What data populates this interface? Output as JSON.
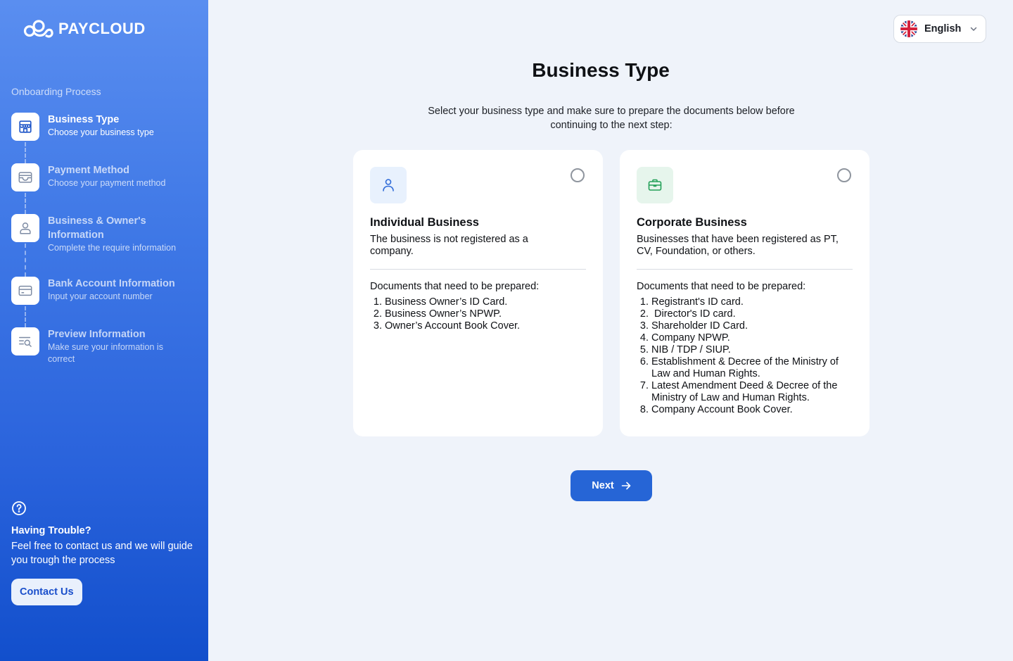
{
  "brand": {
    "name": "PAYCLOUD"
  },
  "sidebar": {
    "section_label": "Onboarding Process",
    "steps": [
      {
        "title": "Business Type",
        "subtitle": "Choose your business type",
        "icon": "store-icon",
        "active": true
      },
      {
        "title": "Payment Method",
        "subtitle": "Choose your payment method",
        "icon": "wallet-icon",
        "active": false
      },
      {
        "title": "Business & Owner's Information",
        "subtitle": "Complete the require information",
        "icon": "person-card-icon",
        "active": false
      },
      {
        "title": "Bank Account Information",
        "subtitle": "Input your account number",
        "icon": "card-icon",
        "active": false
      },
      {
        "title": "Preview Information",
        "subtitle": "Make sure your information is correct",
        "icon": "preview-search-icon",
        "active": false
      }
    ],
    "help": {
      "title": "Having Trouble?",
      "text": "Feel free to contact us and we will guide you trough the process",
      "button": "Contact Us"
    }
  },
  "language": {
    "selected": "English"
  },
  "main": {
    "title": "Business Type",
    "subtitle": "Select your business type and make sure to prepare the documents below before continuing to the next step:",
    "cards": [
      {
        "title": "Individual Business",
        "description": "The business is not registered as a company.",
        "docs_heading": "Documents that need to be prepared:",
        "docs": [
          "Business Owner’s ID Card.",
          "Business Owner’s NPWP.",
          "Owner’s Account Book Cover."
        ],
        "selected": false
      },
      {
        "title": "Corporate Business",
        "description": "Businesses that have been registered as PT, CV, Foundation, or others.",
        "docs_heading": "Documents that need to be prepared:",
        "docs": [
          "Registrant's ID card.",
          " Director's ID card.",
          "Shareholder ID Card.",
          "Company NPWP.",
          "NIB / TDP / SIUP.",
          "Establishment & Decree of the Ministry of Law and Human Rights.",
          "Latest Amendment Deed & Decree of the Ministry of Law and Human Rights.",
          "Company Account Book Cover."
        ],
        "selected": false
      }
    ],
    "next_label": "Next"
  },
  "colors": {
    "primary": "#2665d6",
    "sidebar_top": "#5a8ef0",
    "sidebar_bottom": "#124fcc",
    "background": "#eff3fa"
  }
}
